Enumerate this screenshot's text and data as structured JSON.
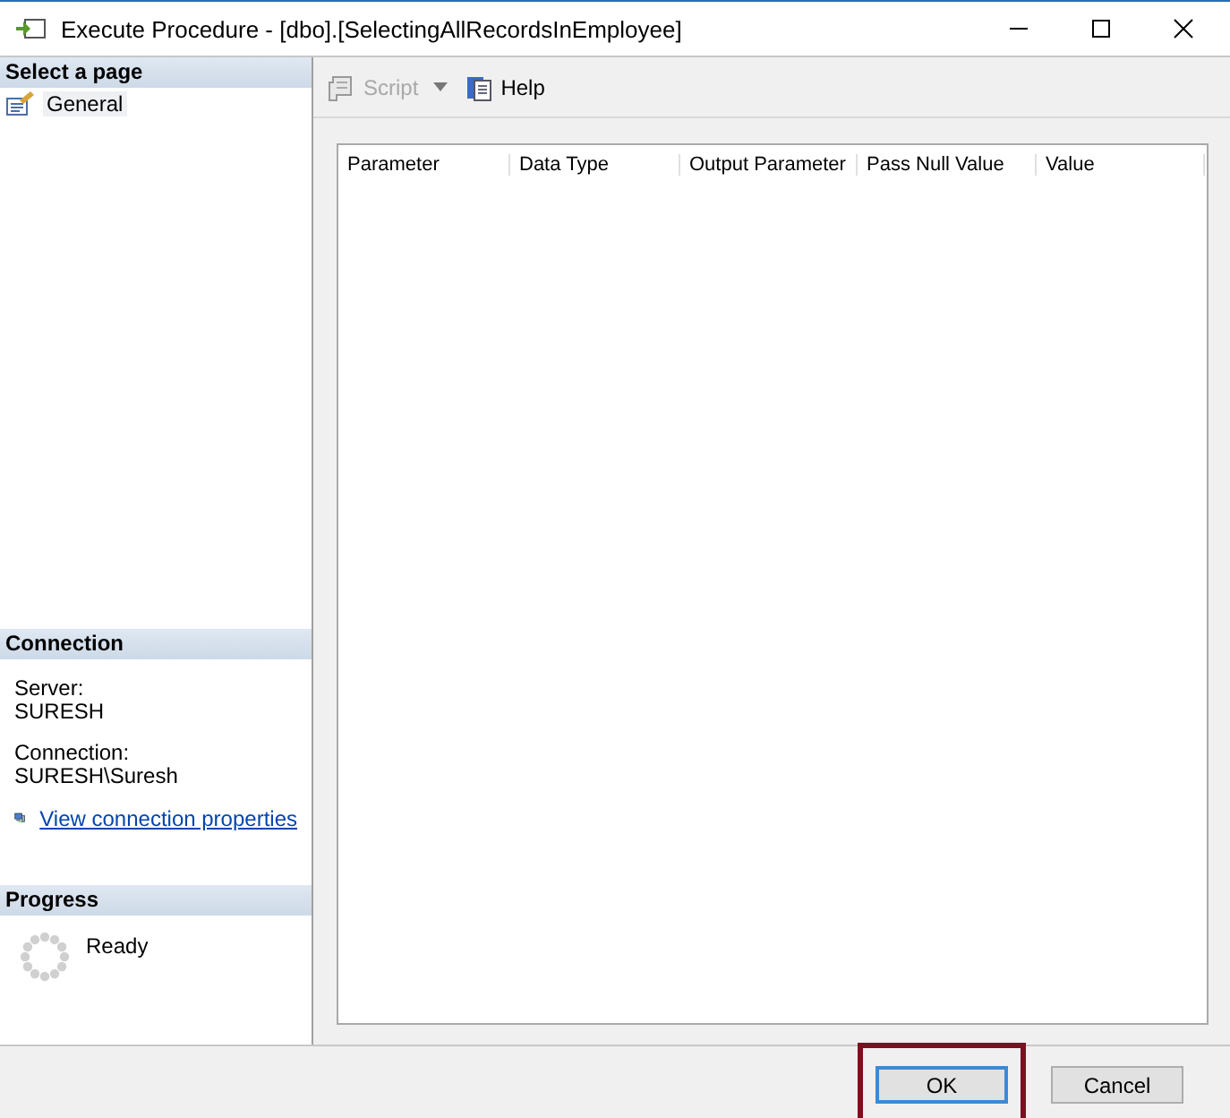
{
  "window": {
    "title": "Execute Procedure - [dbo].[SelectingAllRecordsInEmployee]"
  },
  "sidebar": {
    "title": "Select a page",
    "pages": [
      {
        "label": "General",
        "selected": true
      }
    ]
  },
  "connection": {
    "title": "Connection",
    "fields": [
      {
        "label": "Server:",
        "value": "SURESH"
      },
      {
        "label": "Connection:",
        "value": "SURESH\\Suresh"
      }
    ],
    "link": "View connection properties"
  },
  "progress": {
    "title": "Progress",
    "status": "Ready"
  },
  "toolbar": [
    {
      "kind": "script",
      "label": "Script",
      "disabled": true
    },
    {
      "kind": "help",
      "label": "Help",
      "disabled": false
    }
  ],
  "table": {
    "columns": [
      "Parameter",
      "Data Type",
      "Output Parameter",
      "Pass Null Value",
      "Value"
    ]
  },
  "buttons": [
    {
      "label": "OK",
      "default": true,
      "highlighted": true
    },
    {
      "label": "Cancel",
      "default": false,
      "highlighted": false
    }
  ]
}
